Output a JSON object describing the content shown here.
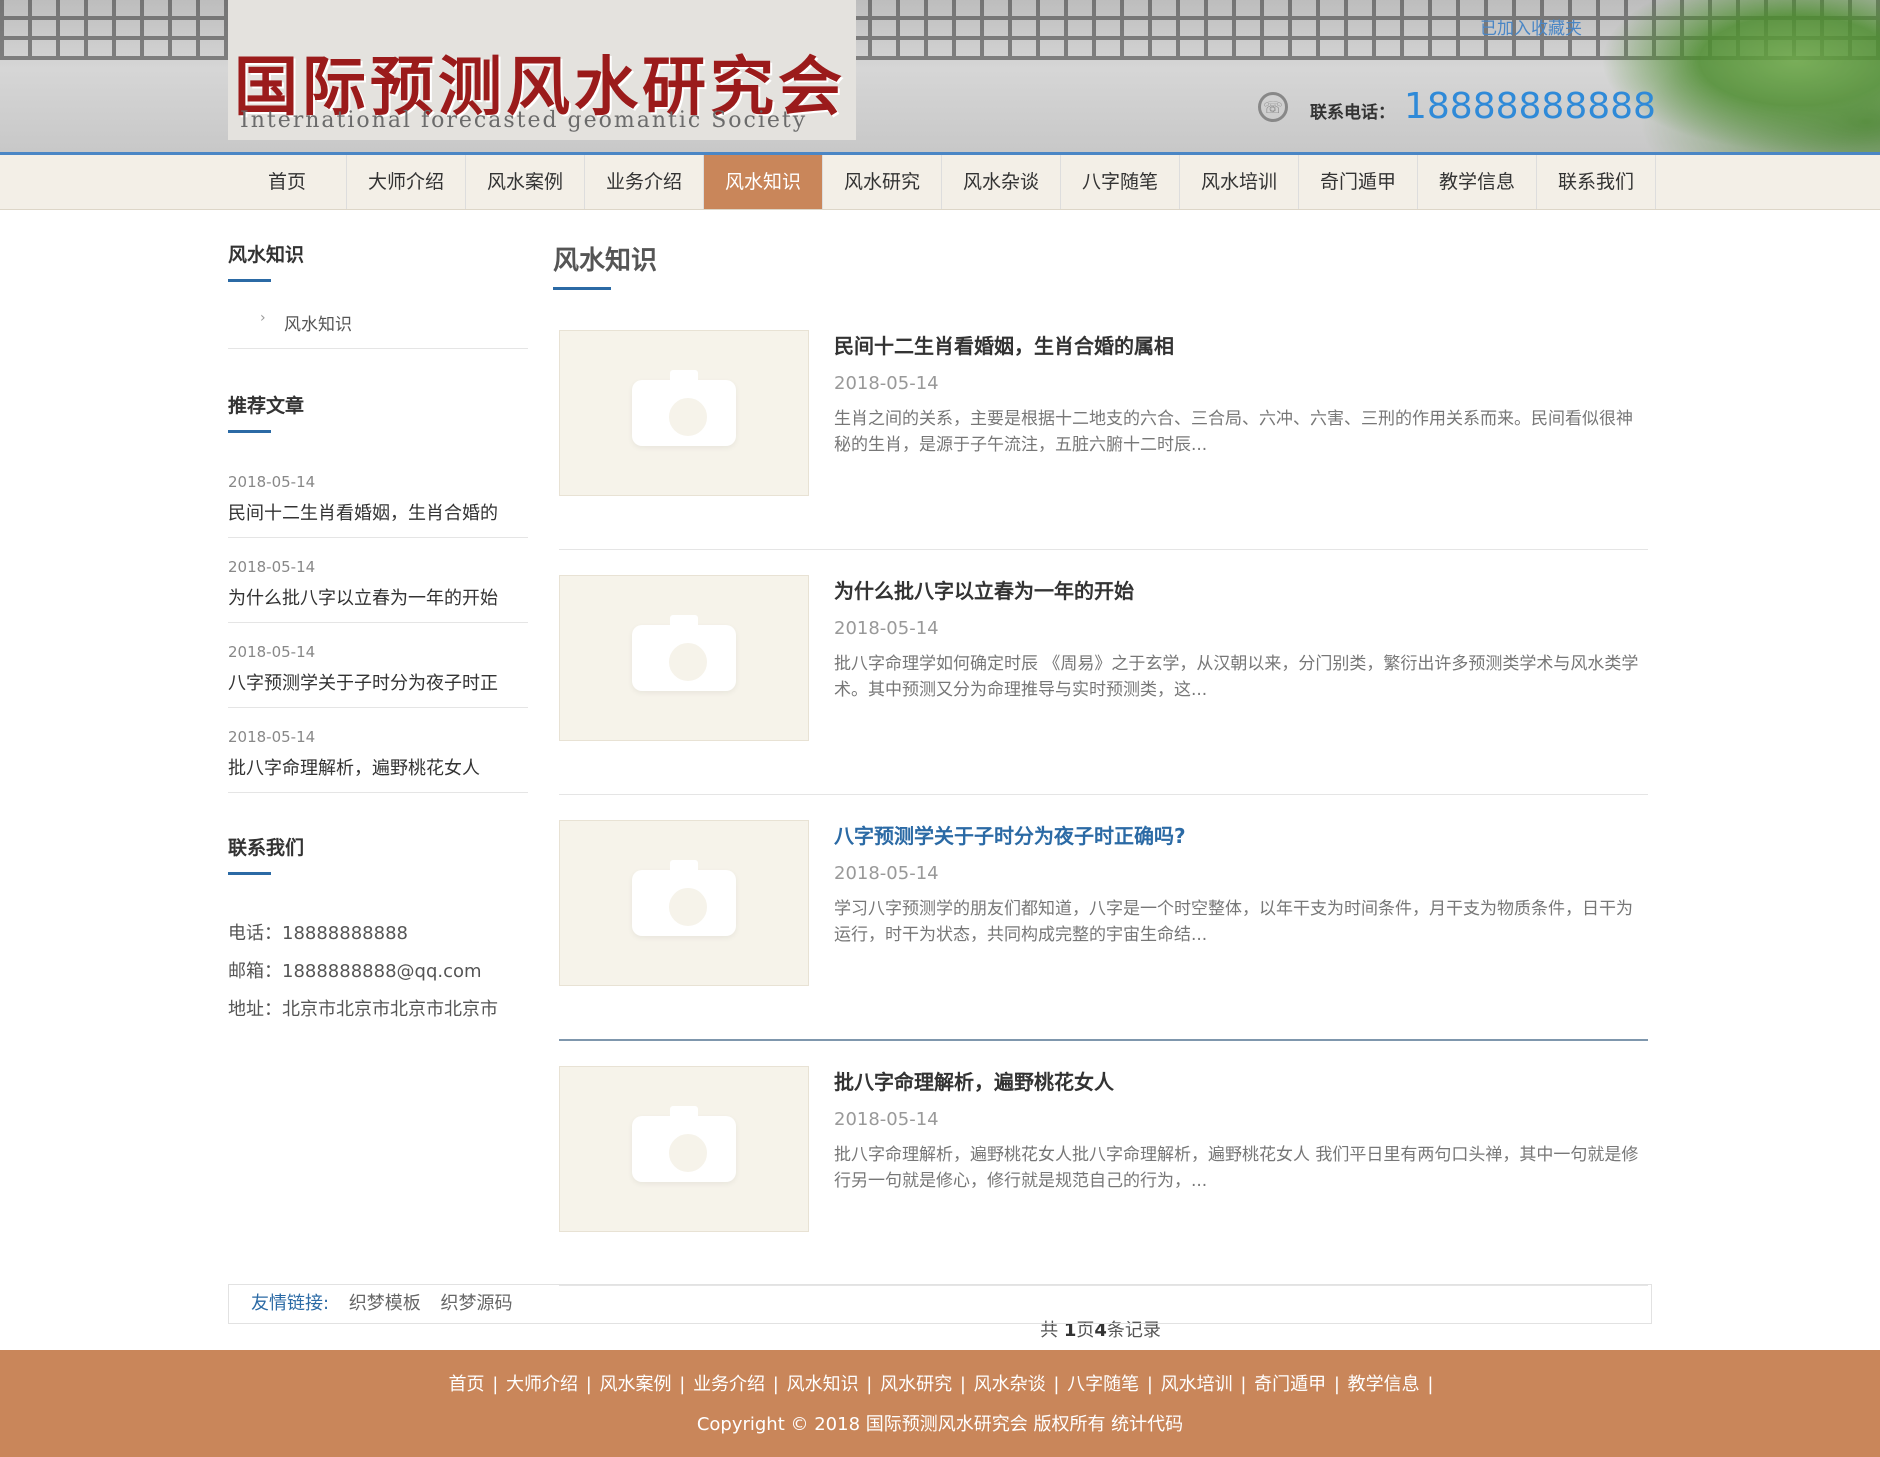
{
  "header": {
    "site_title": "国际预测风水研究会",
    "site_subtitle": "International forecasted geomantic Society",
    "top_link": "已加入收藏夹",
    "phone_label": "联系电话：",
    "phone_number": "18888888888"
  },
  "nav": {
    "items": [
      "首页",
      "大师介绍",
      "风水案例",
      "业务介绍",
      "风水知识",
      "风水研究",
      "风水杂谈",
      "八字随笔",
      "风水培训",
      "奇门遁甲",
      "教学信息",
      "联系我们"
    ],
    "active": "风水知识"
  },
  "sidebar": {
    "category_title": "风水知识",
    "category_item": "风水知识",
    "recommended_title": "推荐文章",
    "recommended": [
      {
        "date": "2018-05-14",
        "title": "民间十二生肖看婚姻，生肖合婚的"
      },
      {
        "date": "2018-05-14",
        "title": "为什么批八字以立春为一年的开始"
      },
      {
        "date": "2018-05-14",
        "title": "八字预测学关于子时分为夜子时正"
      },
      {
        "date": "2018-05-14",
        "title": "批八字命理解析，遍野桃花女人"
      }
    ],
    "contact_title": "联系我们",
    "contact": {
      "phone": "电话：18888888888",
      "email": "邮箱：1888888888@qq.com",
      "address": "地址：北京市北京市北京市北京市"
    }
  },
  "main": {
    "title": "风水知识",
    "articles": [
      {
        "title": "民间十二生肖看婚姻，生肖合婚的属相",
        "date": "2018-05-14",
        "desc": "生肖之间的关系，主要是根据十二地支的六合、三合局、六冲、六害、三刑的作用关系而来。民间看似很神秘的生肖，是源于子午流注，五脏六腑十二时辰..."
      },
      {
        "title": "为什么批八字以立春为一年的开始",
        "date": "2018-05-14",
        "desc": "批八字命理学如何确定时辰 《周易》之于玄学，从汉朝以来，分门别类，繁衍出许多预测类学术与风水类学术。其中预测又分为命理推导与实时预测类，这..."
      },
      {
        "title": "八字预测学关于子时分为夜子时正确吗?",
        "date": "2018-05-14",
        "desc": "学习八字预测学的朋友们都知道，八字是一个时空整体，以年干支为时间条件，月干支为物质条件，日干为运行，时干为状态，共同构成完整的宇宙生命结..."
      },
      {
        "title": "批八字命理解析，遍野桃花女人",
        "date": "2018-05-14",
        "desc": "批八字命理解析，遍野桃花女人批八字命理解析，遍野桃花女人 我们平日里有两句口头禅，其中一句就是修行另一句就是修心，修行就是规范自己的行为，..."
      }
    ],
    "pager_prefix": "共 ",
    "pager_pages": "1",
    "pager_mid": "页",
    "pager_count": "4",
    "pager_suffix": "条记录"
  },
  "links": {
    "label": "友情链接:",
    "items": [
      "织梦模板",
      "织梦源码"
    ]
  },
  "footer": {
    "nav": [
      "首页",
      "大师介绍",
      "风水案例",
      "业务介绍",
      "风水知识",
      "风水研究",
      "风水杂谈",
      "八字随笔",
      "风水培训",
      "奇门遁甲",
      "教学信息"
    ],
    "copyright": "Copyright © 2018 国际预测风水研究会 版权所有  统计代码"
  }
}
